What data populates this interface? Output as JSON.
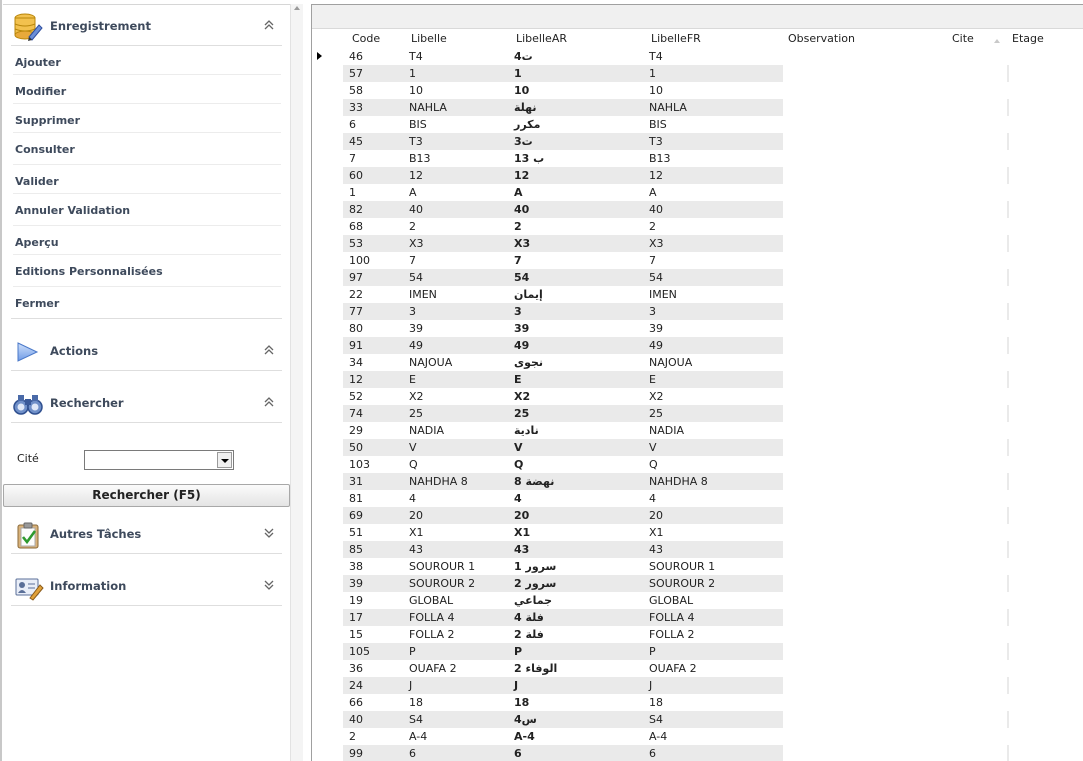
{
  "sidebar": {
    "enregistrement": {
      "title": "Enregistrement",
      "items": [
        "Ajouter",
        "Modifier",
        "Supprimer",
        "Consulter",
        "Valider",
        "Annuler Validation",
        "Aperçu",
        "Editions Personnalisées",
        "Fermer"
      ]
    },
    "actions": {
      "title": "Actions"
    },
    "rechercher": {
      "title": "Rechercher",
      "cite_label": "Cité",
      "cite_value": "",
      "search_button": "Rechercher (F5)"
    },
    "autres": {
      "title": "Autres Tâches"
    },
    "information": {
      "title": "Information"
    }
  },
  "grid": {
    "columns": [
      "Code",
      "Libelle",
      "LibelleAR",
      "LibelleFR",
      "Observation",
      "Cite",
      "Etage"
    ],
    "rows": [
      [
        "46",
        "T4",
        "ت4",
        "T4"
      ],
      [
        "57",
        "1",
        "1",
        "1"
      ],
      [
        "58",
        "10",
        "10",
        "10"
      ],
      [
        "33",
        "NAHLA",
        "نهلة",
        "NAHLA"
      ],
      [
        "6",
        "BIS",
        "مكرر",
        "BIS"
      ],
      [
        "45",
        "T3",
        "ت3",
        "T3"
      ],
      [
        "7",
        "B13",
        "ب 13",
        "B13"
      ],
      [
        "60",
        "12",
        "12",
        "12"
      ],
      [
        "1",
        "A",
        "A",
        "A"
      ],
      [
        "82",
        "40",
        "40",
        "40"
      ],
      [
        "68",
        "2",
        "2",
        "2"
      ],
      [
        "53",
        "X3",
        "X3",
        "X3"
      ],
      [
        "100",
        "7",
        "7",
        "7"
      ],
      [
        "97",
        "54",
        "54",
        "54"
      ],
      [
        "22",
        "IMEN",
        "إيمان",
        "IMEN"
      ],
      [
        "77",
        "3",
        "3",
        "3"
      ],
      [
        "80",
        "39",
        "39",
        "39"
      ],
      [
        "91",
        "49",
        "49",
        "49"
      ],
      [
        "34",
        "NAJOUA",
        "نجوى",
        "NAJOUA"
      ],
      [
        "12",
        "E",
        "E",
        "E"
      ],
      [
        "52",
        "X2",
        "X2",
        "X2"
      ],
      [
        "74",
        "25",
        "25",
        "25"
      ],
      [
        "29",
        "NADIA",
        "نادية",
        "NADIA"
      ],
      [
        "50",
        "V",
        "V",
        "V"
      ],
      [
        "103",
        "Q",
        "Q",
        "Q"
      ],
      [
        "31",
        "NAHDHA 8",
        "نهضة 8",
        "NAHDHA 8"
      ],
      [
        "81",
        "4",
        "4",
        "4"
      ],
      [
        "69",
        "20",
        "20",
        "20"
      ],
      [
        "51",
        "X1",
        "X1",
        "X1"
      ],
      [
        "85",
        "43",
        "43",
        "43"
      ],
      [
        "38",
        "SOUROUR 1",
        "سرور 1",
        "SOUROUR 1"
      ],
      [
        "39",
        "SOUROUR 2",
        "سرور 2",
        "SOUROUR 2"
      ],
      [
        "19",
        "GLOBAL",
        "جماعي",
        "GLOBAL"
      ],
      [
        "17",
        "FOLLA 4",
        "فلة 4",
        "FOLLA 4"
      ],
      [
        "15",
        "FOLLA 2",
        "فلة 2",
        "FOLLA 2"
      ],
      [
        "105",
        "P",
        "P",
        "P"
      ],
      [
        "36",
        "OUAFA 2",
        "الوفاء 2",
        "OUAFA 2"
      ],
      [
        "24",
        "J",
        "J",
        "J"
      ],
      [
        "66",
        "18",
        "18",
        "18"
      ],
      [
        "40",
        "S4",
        "س4",
        "S4"
      ],
      [
        "2",
        "A-4",
        "A-4",
        "A-4"
      ],
      [
        "99",
        "6",
        "6",
        "6"
      ]
    ]
  }
}
